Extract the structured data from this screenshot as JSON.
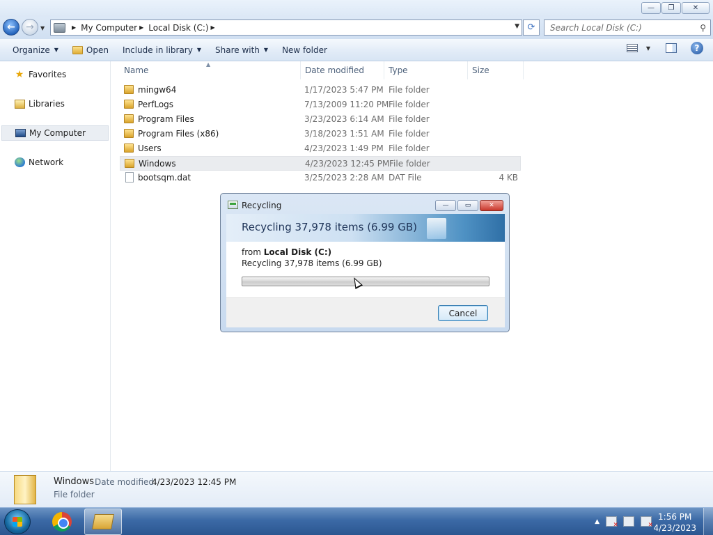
{
  "window": {
    "controls": {
      "minimize": "—",
      "maximize": "❐",
      "close": "✕"
    }
  },
  "address": {
    "back_icon": "back-arrow-icon",
    "forward_icon": "forward-arrow-icon",
    "crumbs": [
      "My Computer",
      "Local Disk (C:)"
    ],
    "refresh_glyph": "⟳",
    "search_placeholder": "Search Local Disk (C:)"
  },
  "toolbar": {
    "organize": "Organize",
    "open": "Open",
    "include_in_library": "Include in library",
    "share_with": "Share with",
    "new_folder": "New folder",
    "help": "?"
  },
  "navigation": {
    "items": [
      {
        "label": "Favorites",
        "icon": "star-icon"
      },
      {
        "label": "Libraries",
        "icon": "libraries-icon"
      },
      {
        "label": "My Computer",
        "icon": "computer-icon",
        "selected": true
      },
      {
        "label": "Network",
        "icon": "network-icon"
      }
    ]
  },
  "file_list": {
    "columns": {
      "name": "Name",
      "date_modified": "Date modified",
      "type": "Type",
      "size": "Size"
    },
    "rows": [
      {
        "name": "mingw64",
        "date": "1/17/2023 5:47 PM",
        "type": "File folder",
        "size": "",
        "kind": "folder"
      },
      {
        "name": "PerfLogs",
        "date": "7/13/2009 11:20 PM",
        "type": "File folder",
        "size": "",
        "kind": "folder"
      },
      {
        "name": "Program Files",
        "date": "3/23/2023 6:14 AM",
        "type": "File folder",
        "size": "",
        "kind": "folder"
      },
      {
        "name": "Program Files (x86)",
        "date": "3/18/2023 1:51 AM",
        "type": "File folder",
        "size": "",
        "kind": "folder"
      },
      {
        "name": "Users",
        "date": "4/23/2023 1:49 PM",
        "type": "File folder",
        "size": "",
        "kind": "folder"
      },
      {
        "name": "Windows",
        "date": "4/23/2023 12:45 PM",
        "type": "File folder",
        "size": "",
        "kind": "folder",
        "selected": true
      },
      {
        "name": "bootsqm.dat",
        "date": "3/25/2023 2:28 AM",
        "type": "DAT File",
        "size": "4 KB",
        "kind": "file"
      }
    ]
  },
  "details_pane": {
    "name": "Windows",
    "date_label": "Date modified:",
    "date_value": "4/23/2023 12:45 PM",
    "type": "File folder"
  },
  "dialog": {
    "title": "Recycling",
    "heading": "Recycling 37,978 items (6.99 GB)",
    "from_prefix": "from",
    "from_location": "Local Disk (C:)",
    "detail": "Recycling 37,978 items (6.99 GB)",
    "progress": 0,
    "cancel": "Cancel",
    "controls": {
      "minimize": "—",
      "maximize": "▭",
      "close": "✕"
    }
  },
  "taskbar": {
    "apps": [
      "chrome-icon",
      "windows-explorer-icon"
    ],
    "tray_arrow": "▲",
    "time": "1:56 PM",
    "date": "4/23/2023"
  }
}
